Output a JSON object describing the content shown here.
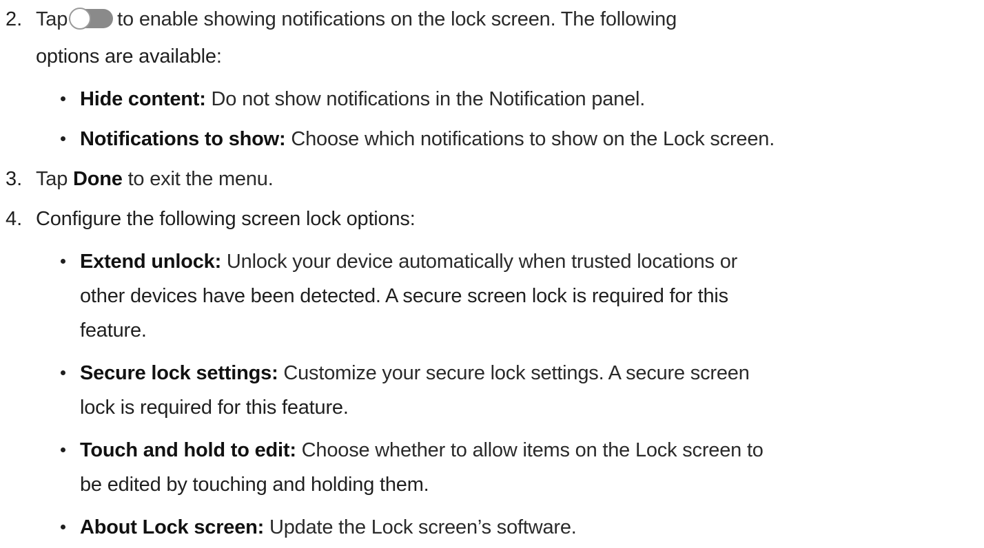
{
  "steps": [
    {
      "number": "2.",
      "prefix": "Tap",
      "toggle_icon": "toggle-off-icon",
      "suffix": "to enable showing notifications on the lock screen. The following",
      "continuation": "options are available:",
      "bullets": [
        {
          "term": "Hide content",
          "sep": ":",
          "text": " Do not show notifications in the Notification panel."
        },
        {
          "term": "Notifications to show",
          "sep": ":",
          "text": " Choose which notifications to show on the Lock screen."
        }
      ]
    },
    {
      "number": "3.",
      "prefix": "Tap ",
      "bold": "Done",
      "suffix": " to exit the menu."
    },
    {
      "number": "4.",
      "text": "Configure the following screen lock options:",
      "bullets": [
        {
          "term": "Extend unlock",
          "sep": ":",
          "lines": [
            " Unlock your device automatically when trusted locations or",
            "other devices have been detected. A secure screen lock is required for this",
            "feature."
          ]
        },
        {
          "term": "Secure lock settings",
          "sep": ":",
          "lines": [
            " Customize your secure lock settings. A secure screen",
            "lock is required for this feature."
          ]
        },
        {
          "term": "Touch and hold to edit",
          "sep": ":",
          "lines": [
            " Choose whether to allow items on the Lock screen to",
            "be edited by touching and holding them."
          ]
        },
        {
          "term": "About Lock screen",
          "sep": ":",
          "lines": [
            " Update the Lock screen’s software."
          ]
        }
      ]
    }
  ],
  "colors": {
    "text": "#1f1f1f",
    "toggle_track": "#8a8a8a",
    "toggle_knob_border": "#9a9a9a"
  }
}
